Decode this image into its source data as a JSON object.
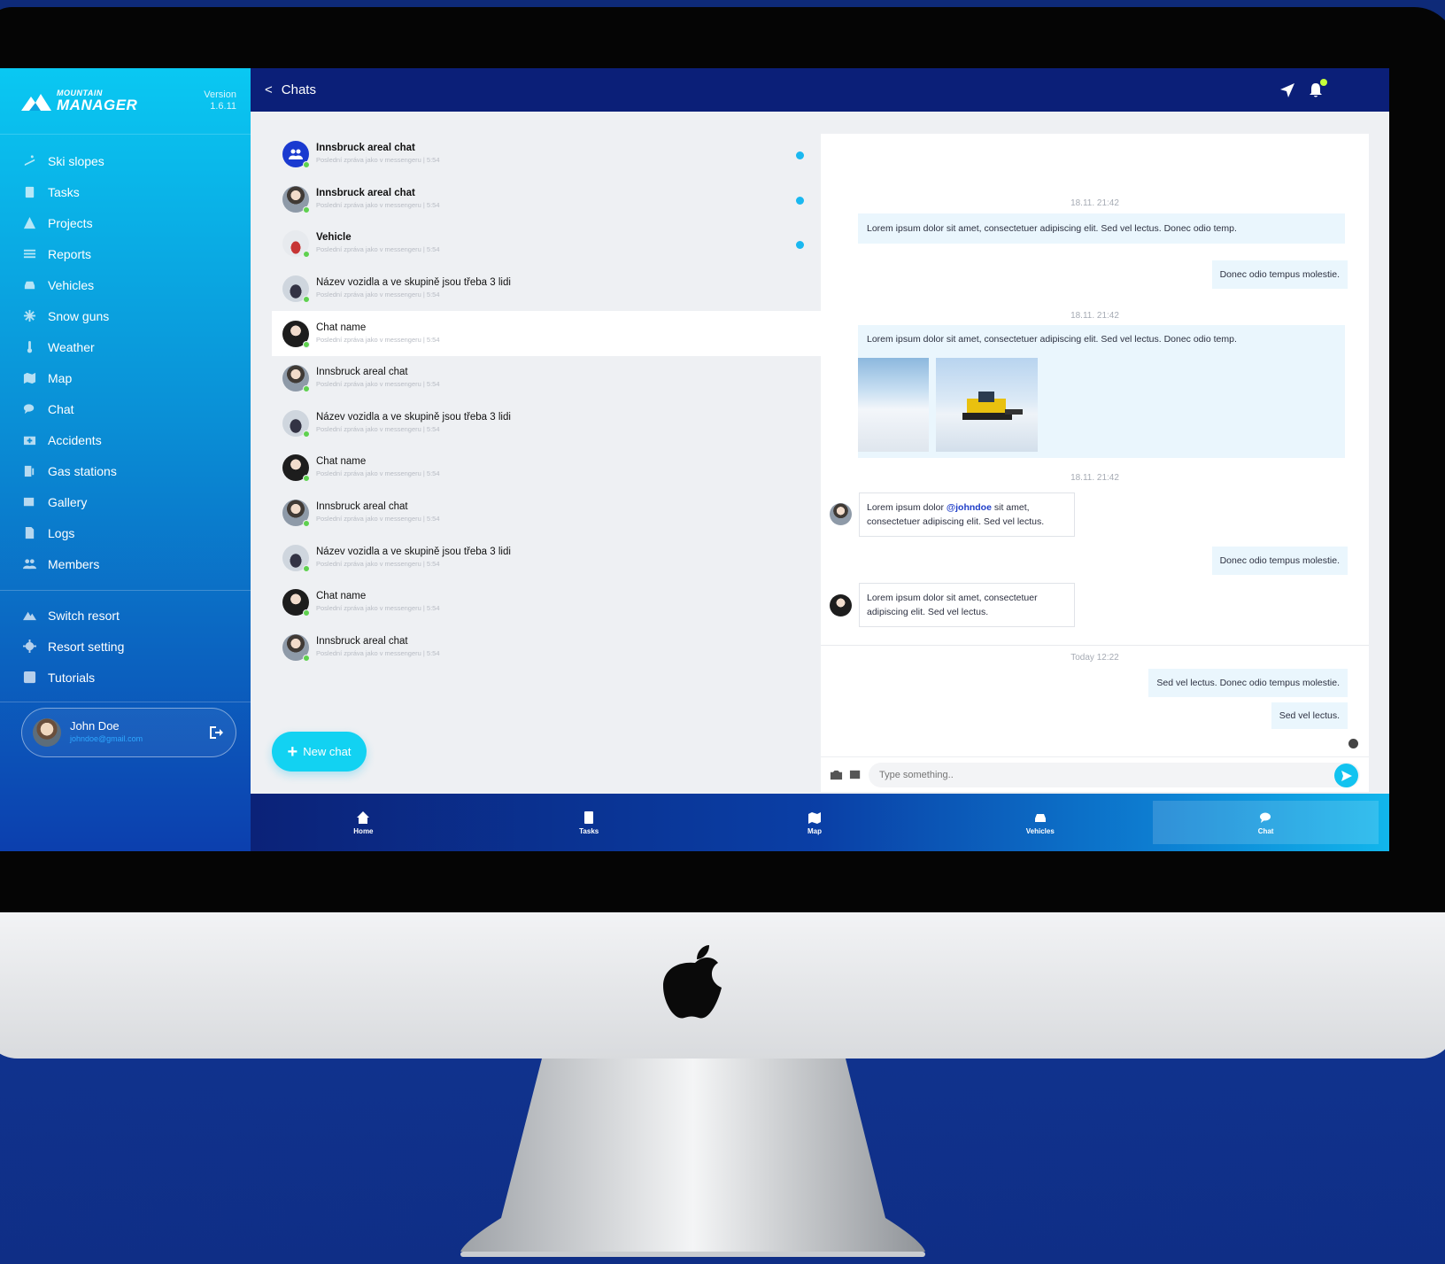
{
  "brand": {
    "small": "MOUNTAIN",
    "big": "MANAGER",
    "version_label": "Version",
    "version_number": "1.6.11"
  },
  "sidebar": {
    "items": [
      {
        "label": "Ski slopes",
        "icon": "ski-icon"
      },
      {
        "label": "Tasks",
        "icon": "clipboard-icon"
      },
      {
        "label": "Projects",
        "icon": "warning-icon"
      },
      {
        "label": "Reports",
        "icon": "list-icon"
      },
      {
        "label": "Vehicles",
        "icon": "car-icon"
      },
      {
        "label": "Snow guns",
        "icon": "snowflake-icon"
      },
      {
        "label": "Weather",
        "icon": "thermometer-icon"
      },
      {
        "label": "Map",
        "icon": "map-icon"
      },
      {
        "label": "Chat",
        "icon": "chat-icon"
      },
      {
        "label": "Accidents",
        "icon": "first-aid-icon"
      },
      {
        "label": "Gas stations",
        "icon": "gas-station-icon"
      },
      {
        "label": "Gallery",
        "icon": "gallery-icon"
      },
      {
        "label": "Logs",
        "icon": "document-icon"
      },
      {
        "label": "Members",
        "icon": "members-icon"
      }
    ],
    "secondary": [
      {
        "label": "Switch resort",
        "icon": "mountain-icon"
      },
      {
        "label": "Resort setting",
        "icon": "gear-icon"
      },
      {
        "label": "Tutorials",
        "icon": "help-icon"
      }
    ]
  },
  "user": {
    "name": "John Doe",
    "email": "johndoe@gmail.com"
  },
  "topbar": {
    "back": "<",
    "title": "Chats"
  },
  "chats": [
    {
      "name": "Innsbruck areal chat",
      "sub": "Poslední zpráva jako v messengeru | 5:54",
      "bold": true,
      "unread": true,
      "avatar": "group"
    },
    {
      "name": "Innsbruck areal chat",
      "sub": "Poslední zpráva jako v messengeru | 5:54",
      "bold": true,
      "unread": true,
      "avatar": "person"
    },
    {
      "name": "Vehicle",
      "sub": "Poslední zpráva jako v messengeru | 5:54",
      "bold": true,
      "unread": true,
      "avatar": "vehicle"
    },
    {
      "name": "Název vozidla a ve skupině jsou třeba 3 lidi",
      "sub": "Poslední zpráva jako v messengeru | 5:54",
      "bold": false,
      "unread": false,
      "avatar": "snow"
    },
    {
      "name": "Chat name",
      "sub": "Poslední zpráva jako v messengeru | 5:54",
      "bold": false,
      "unread": false,
      "avatar": "dark",
      "active": true
    },
    {
      "name": "Innsbruck areal chat",
      "sub": "Poslední zpráva jako v messengeru | 5:54",
      "bold": false,
      "unread": false,
      "avatar": "person"
    },
    {
      "name": "Název vozidla a ve skupině jsou třeba 3 lidi",
      "sub": "Poslední zpráva jako v messengeru | 5:54",
      "bold": false,
      "unread": false,
      "avatar": "snow"
    },
    {
      "name": "Chat name",
      "sub": "Poslední zpráva jako v messengeru | 5:54",
      "bold": false,
      "unread": false,
      "avatar": "dark"
    },
    {
      "name": "Innsbruck areal chat",
      "sub": "Poslední zpráva jako v messengeru | 5:54",
      "bold": false,
      "unread": false,
      "avatar": "person"
    },
    {
      "name": "Název vozidla a ve skupině jsou třeba 3 lidi",
      "sub": "Poslední zpráva jako v messengeru | 5:54",
      "bold": false,
      "unread": false,
      "avatar": "snow"
    },
    {
      "name": "Chat name",
      "sub": "Poslední zpráva jako v messengeru | 5:54",
      "bold": false,
      "unread": false,
      "avatar": "dark"
    },
    {
      "name": "Innsbruck areal chat",
      "sub": "Poslední zpráva jako v messengeru | 5:54",
      "bold": false,
      "unread": false,
      "avatar": "person"
    }
  ],
  "new_chat": {
    "plus": "+",
    "label": "New chat"
  },
  "conversation": {
    "ts1": "18.11. 21:42",
    "msg1": "Lorem ipsum dolor sit amet, consectetuer adipiscing elit. Sed vel lectus. Donec odio temp.",
    "msg2": "Donec odio tempus molestie.",
    "ts2": "18.11. 21:42",
    "msg3": "Lorem ipsum dolor sit amet, consectetuer adipiscing elit. Sed vel lectus. Donec odio temp.",
    "ts3": "18.11. 21:42",
    "msg4_before": "Lorem ipsum dolor ",
    "msg4_mention": "@johndoe",
    "msg4_after": " sit amet, consectetuer adipiscing elit. Sed vel lectus.",
    "msg5": "Donec odio tempus molestie.",
    "msg6": "Lorem ipsum dolor sit amet, consectetuer adipiscing elit. Sed vel lectus.",
    "ts4": "Today 12:22",
    "msg7": "Sed vel lectus. Donec odio tempus molestie.",
    "msg8": "Sed vel lectus."
  },
  "composer": {
    "placeholder": "Type something.."
  },
  "bottom_nav": [
    {
      "label": "Home",
      "icon": "home-icon"
    },
    {
      "label": "Tasks",
      "icon": "tasks-icon"
    },
    {
      "label": "Map",
      "icon": "map-icon"
    },
    {
      "label": "Vehicles",
      "icon": "car-icon"
    },
    {
      "label": "Chat",
      "icon": "chat-icon",
      "active": true
    }
  ],
  "colors": {
    "accent": "#12d2f2",
    "topbar": "#0b1f78",
    "unread": "#1ab8f0",
    "online": "#5fd14f"
  }
}
